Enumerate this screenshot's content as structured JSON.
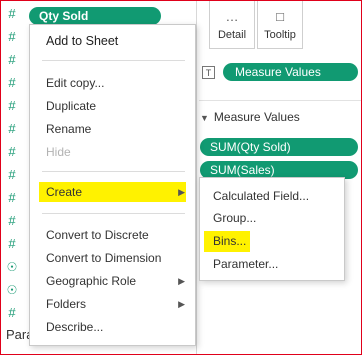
{
  "data_pane": {
    "qty_pill_label": "Qty Sold",
    "partial_label": "Para",
    "field_icons": [
      "number-icon",
      "number-icon",
      "number-icon",
      "number-icon",
      "number-icon",
      "number-icon",
      "number-icon",
      "number-icon",
      "number-icon",
      "number-icon",
      "number-icon",
      "globe-icon",
      "globe-icon",
      "number-icon",
      "number-icon"
    ]
  },
  "context_menu": {
    "items": [
      {
        "label": "Add to Sheet"
      },
      {
        "label": "Edit copy..."
      },
      {
        "label": "Duplicate"
      },
      {
        "label": "Rename"
      },
      {
        "label": "Hide",
        "disabled": true
      },
      {
        "label": "Create",
        "has_submenu": true,
        "highlighted": true
      },
      {
        "label": "Convert to Discrete"
      },
      {
        "label": "Convert to Dimension"
      },
      {
        "label": "Geographic Role",
        "has_submenu": true
      },
      {
        "label": "Folders",
        "has_submenu": true
      },
      {
        "label": "Describe..."
      }
    ]
  },
  "marks_card": {
    "detail_label": "Detail",
    "tooltip_label": "Tooltip",
    "text_pill": "Measure Values"
  },
  "measure_values": {
    "header": "Measure Values",
    "pills": [
      "SUM(Qty Sold)",
      "SUM(Sales)"
    ]
  },
  "create_submenu": {
    "items": [
      {
        "label": "Calculated Field..."
      },
      {
        "label": "Group..."
      },
      {
        "label": "Bins...",
        "highlighted": true
      },
      {
        "label": "Parameter..."
      }
    ]
  },
  "colors": {
    "pill_green": "#119a72",
    "highlight_yellow": "#fff200",
    "frame_red": "#e0001a"
  }
}
